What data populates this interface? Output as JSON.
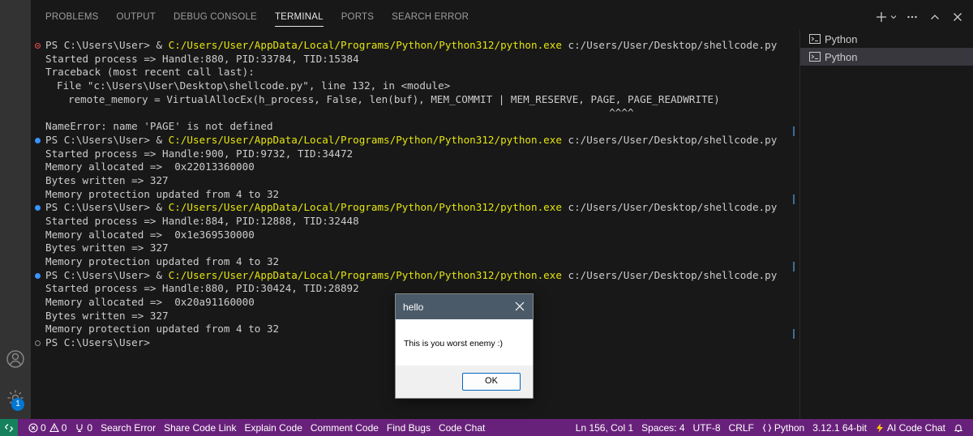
{
  "panel": {
    "tabs": [
      {
        "label": "PROBLEMS"
      },
      {
        "label": "OUTPUT"
      },
      {
        "label": "DEBUG CONSOLE"
      },
      {
        "label": "TERMINAL"
      },
      {
        "label": "PORTS"
      },
      {
        "label": "SEARCH ERROR"
      }
    ],
    "active_tab": "TERMINAL"
  },
  "terminal": {
    "lines": [
      {
        "marker": "error",
        "prompt": "PS C:\\Users\\User> & ",
        "cmd": "C:/Users/User/AppData/Local/Programs/Python/Python312/python.exe",
        "arg": " c:/Users/User/Desktop/shellcode.py"
      },
      {
        "text": "Started process => Handle:880, PID:33784, TID:15384"
      },
      {
        "text": "Traceback (most recent call last):"
      },
      {
        "text": "File \"c:\\Users\\User\\Desktop\\shellcode.py\", line 132, in <module>",
        "indent": 1
      },
      {
        "text": "remote_memory = VirtualAllocEx(h_process, False, len(buf), MEM_COMMIT | MEM_RESERVE, PAGE, PAGE_READWRITE)",
        "indent": 2
      },
      {
        "text": "                                                                                        ^^^^",
        "indent": 2
      },
      {
        "text": "NameError: name 'PAGE' is not defined"
      },
      {
        "marker": "ok",
        "prompt": "PS C:\\Users\\User> & ",
        "cmd": "C:/Users/User/AppData/Local/Programs/Python/Python312/python.exe",
        "arg": " c:/Users/User/Desktop/shellcode.py"
      },
      {
        "text": "Started process => Handle:900, PID:9732, TID:34472"
      },
      {
        "text": "Memory allocated =>  0x22013360000"
      },
      {
        "text": "Bytes written => 327"
      },
      {
        "text": "Memory protection updated from 4 to 32"
      },
      {
        "marker": "ok",
        "prompt": "PS C:\\Users\\User> & ",
        "cmd": "C:/Users/User/AppData/Local/Programs/Python/Python312/python.exe",
        "arg": " c:/Users/User/Desktop/shellcode.py"
      },
      {
        "text": "Started process => Handle:884, PID:12888, TID:32448"
      },
      {
        "text": "Memory allocated =>  0x1e369530000"
      },
      {
        "text": "Bytes written => 327"
      },
      {
        "text": "Memory protection updated from 4 to 32"
      },
      {
        "marker": "ok",
        "prompt": "PS C:\\Users\\User> & ",
        "cmd": "C:/Users/User/AppData/Local/Programs/Python/Python312/python.exe",
        "arg": " c:/Users/User/Desktop/shellcode.py"
      },
      {
        "text": "Started process => Handle:880, PID:30424, TID:28892"
      },
      {
        "text": "Memory allocated =>  0x20a91160000"
      },
      {
        "text": "Bytes written => 327"
      },
      {
        "text": "Memory protection updated from 4 to 32"
      },
      {
        "marker": "empty",
        "text": "PS C:\\Users\\User>"
      }
    ]
  },
  "terminal_list": {
    "items": [
      {
        "label": "Python",
        "selected": false
      },
      {
        "label": "Python",
        "selected": true
      }
    ]
  },
  "dialog": {
    "title": "hello",
    "message": "This is you worst enemy :)",
    "ok_label": "OK"
  },
  "activity_bar": {
    "settings_badge": "1"
  },
  "statusbar": {
    "errors": "0",
    "warnings": "0",
    "ports": "0",
    "left_items": [
      "Search Error",
      "Share Code Link",
      "Explain Code",
      "Comment Code",
      "Find Bugs",
      "Code Chat"
    ],
    "position": "Ln 156, Col 1",
    "spaces": "Spaces: 4",
    "encoding": "UTF-8",
    "eol": "CRLF",
    "language": "Python",
    "interpreter": "3.12.1 64-bit",
    "ai_chat": "AI Code Chat"
  },
  "colors": {
    "statusbar": "#68217a",
    "remote": "#16825d",
    "accent": "#0078d4",
    "cmd_yellow": "#e5e510"
  }
}
